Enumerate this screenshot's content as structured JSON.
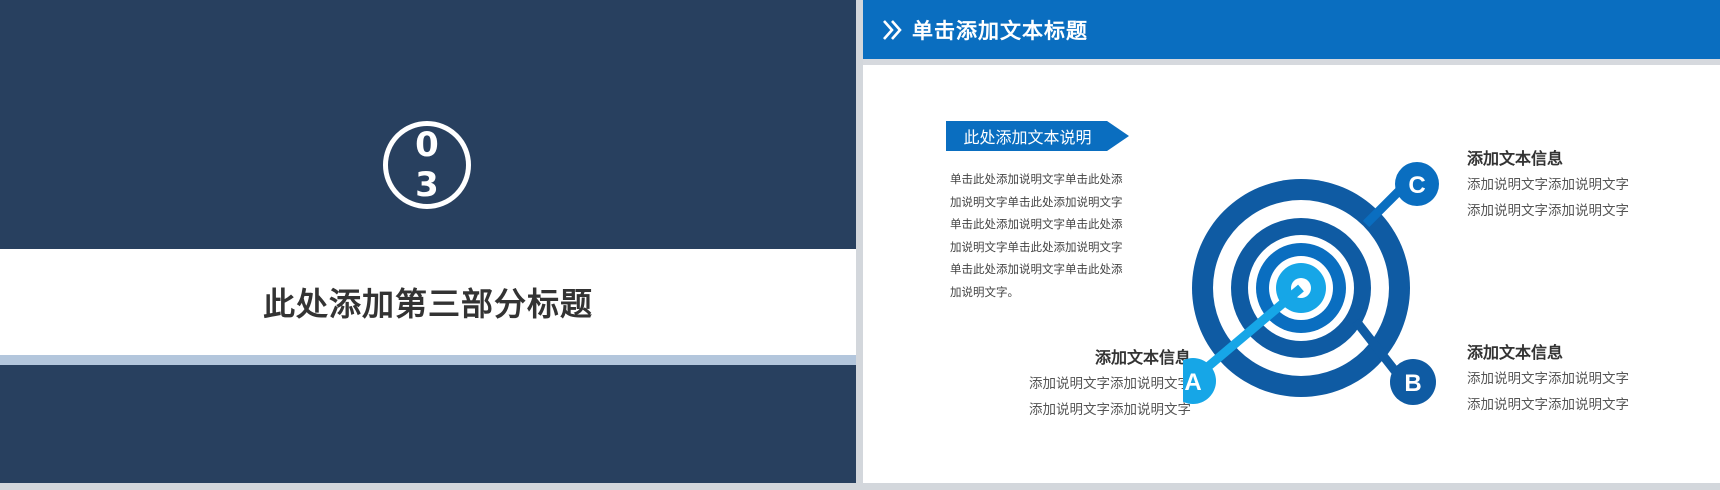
{
  "left_slide": {
    "section_number": [
      "0",
      "3"
    ],
    "section_title": "此处添加第三部分标题",
    "colors": {
      "navy": "#28405f",
      "light_band": "#b3c6dc"
    }
  },
  "right_slide": {
    "header": {
      "title": "单击添加文本标题",
      "icon": "double-chevron-right-icon"
    },
    "tag_label": "此处添加文本说明",
    "description_lines": [
      "单击此处添加说明文字单击此处添",
      "加说明文字单击此处添加说明文字",
      "单击此处添加说明文字单击此处添",
      "加说明文字单击此处添加说明文字",
      "单击此处添加说明文字单击此处添",
      "加说明文字。"
    ],
    "info_a": {
      "title": "添加文本信息",
      "lines": [
        "添加说明文字添加说明文字",
        "添加说明文字添加说明文字"
      ]
    },
    "info_c": {
      "title": "添加文本信息",
      "lines": [
        "添加说明文字添加说明文字",
        "添加说明文字添加说明文字"
      ]
    },
    "info_b": {
      "title": "添加文本信息",
      "lines": [
        "添加说明文字添加说明文字",
        "添加说明文字添加说明文字"
      ]
    },
    "target": {
      "label_a": "A",
      "label_b": "B",
      "label_c": "C"
    },
    "colors": {
      "primary": "#0a6ec0",
      "dark_blue": "#0f5ba3",
      "light_blue": "#16a6e7"
    }
  }
}
